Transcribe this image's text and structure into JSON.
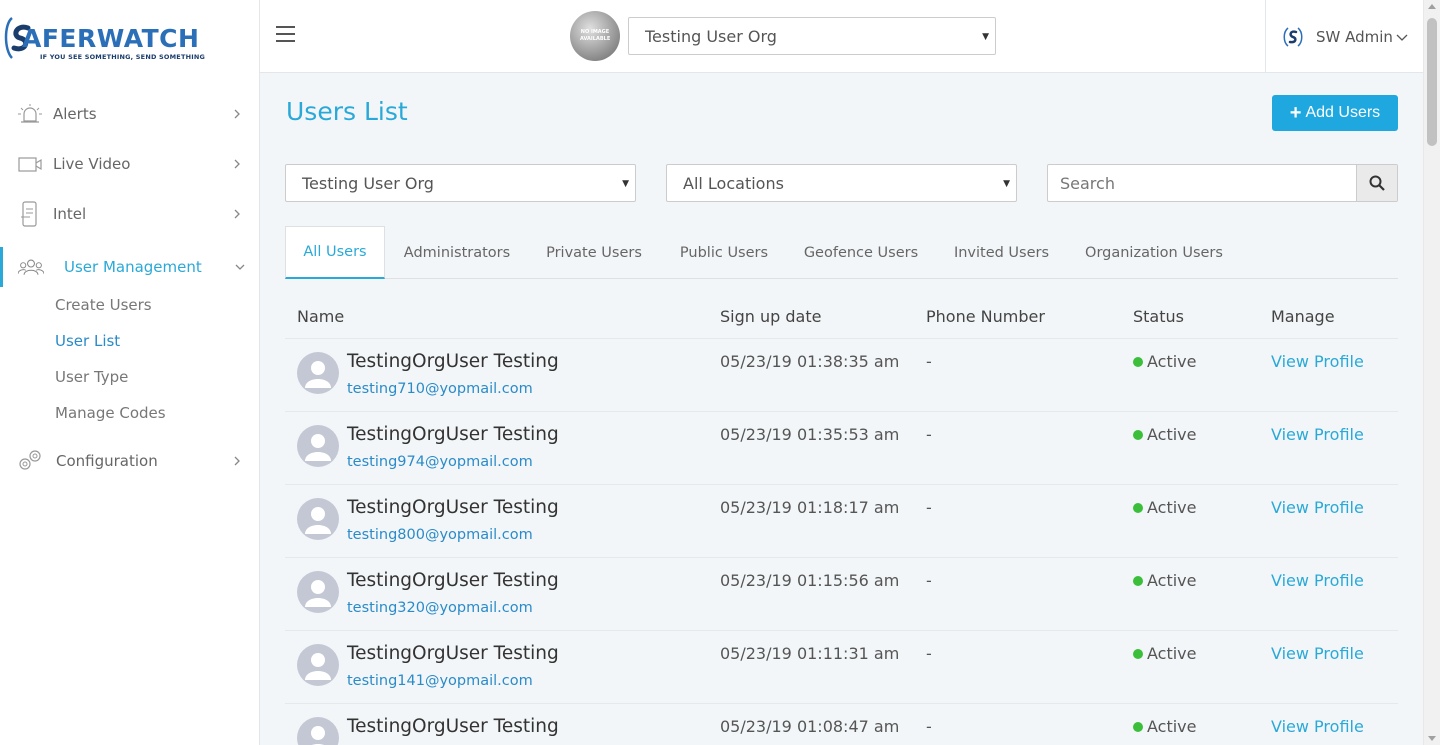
{
  "brand": {
    "logo_main": "AFERWATCH",
    "logo_tagline": "IF YOU SEE SOMETHING, SEND SOMETHING"
  },
  "sidebar": {
    "items": [
      {
        "label": "Alerts",
        "icon": "siren-icon"
      },
      {
        "label": "Live Video",
        "icon": "video-camera-icon"
      },
      {
        "label": "Intel",
        "icon": "phone-document-icon"
      },
      {
        "label": "User Management",
        "icon": "users-icon"
      },
      {
        "label": "Configuration",
        "icon": "gears-icon"
      }
    ],
    "sub_items": [
      {
        "label": "Create Users"
      },
      {
        "label": "User List"
      },
      {
        "label": "User Type"
      },
      {
        "label": "Manage Codes"
      }
    ]
  },
  "topbar": {
    "org_avatar_text": "NO IMAGE AVAILABLE",
    "org_select": "Testing User Org",
    "user_name": "SW Admin"
  },
  "main": {
    "title": "Users List",
    "add_button": "Add Users",
    "filters": {
      "org": "Testing User Org",
      "location": "All Locations",
      "search_placeholder": "Search"
    },
    "tabs": [
      {
        "label": "All Users"
      },
      {
        "label": "Administrators"
      },
      {
        "label": "Private Users"
      },
      {
        "label": "Public Users"
      },
      {
        "label": "Geofence Users"
      },
      {
        "label": "Invited Users"
      },
      {
        "label": "Organization Users"
      }
    ],
    "table": {
      "headers": [
        "Name",
        "Sign up date",
        "Phone Number",
        "Status",
        "Manage"
      ],
      "rows": [
        {
          "name": "TestingOrgUser Testing",
          "email": "testing710@yopmail.com",
          "date": "05/23/19 01:38:35 am",
          "phone": "-",
          "status": "Active",
          "manage": "View Profile"
        },
        {
          "name": "TestingOrgUser Testing",
          "email": "testing974@yopmail.com",
          "date": "05/23/19 01:35:53 am",
          "phone": "-",
          "status": "Active",
          "manage": "View Profile"
        },
        {
          "name": "TestingOrgUser Testing",
          "email": "testing800@yopmail.com",
          "date": "05/23/19 01:18:17 am",
          "phone": "-",
          "status": "Active",
          "manage": "View Profile"
        },
        {
          "name": "TestingOrgUser Testing",
          "email": "testing320@yopmail.com",
          "date": "05/23/19 01:15:56 am",
          "phone": "-",
          "status": "Active",
          "manage": "View Profile"
        },
        {
          "name": "TestingOrgUser Testing",
          "email": "testing141@yopmail.com",
          "date": "05/23/19 01:11:31 am",
          "phone": "-",
          "status": "Active",
          "manage": "View Profile"
        },
        {
          "name": "TestingOrgUser Testing",
          "email": "",
          "date": "05/23/19 01:08:47 am",
          "phone": "-",
          "status": "Active",
          "manage": "View Profile"
        }
      ]
    }
  },
  "colors": {
    "accent": "#2aa9d8",
    "button": "#1fa8df",
    "active_status": "#3bbf3b"
  }
}
